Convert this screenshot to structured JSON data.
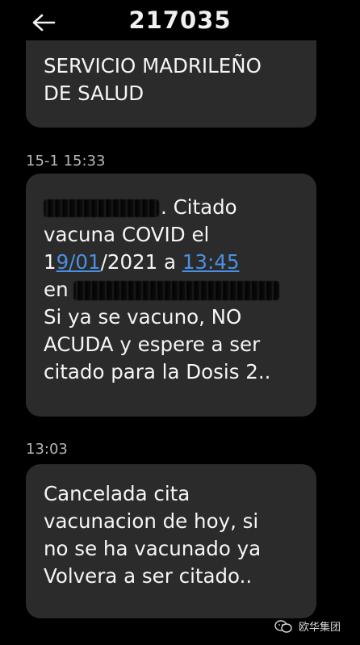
{
  "header": {
    "back_icon": "back-arrow-icon",
    "title": "217035"
  },
  "messages": [
    {
      "lines": [
        "SERVICIO MADRILEÑO",
        "DE SALUD"
      ]
    },
    {
      "timestamp": "15-1 15:33",
      "line1_text": ". Citado",
      "line2": "vacuna COVID el",
      "line3_pre": "1",
      "line3_link_date": "9/01",
      "line3_mid": "/2021 a ",
      "line3_link_time": "13:45",
      "line4_pre": "en",
      "line5": "Si ya se vacuno, NO",
      "line6": "ACUDA y espere a ser",
      "line7": "citado para la Dosis 2.."
    },
    {
      "timestamp": "13:03",
      "lines": [
        "Cancelada cita",
        "vacunacion de hoy, si",
        "no se ha vacunado ya",
        "Volvera a ser citado.."
      ]
    }
  ],
  "watermark": {
    "icon": "wechat-icon",
    "text": "欧华集团"
  },
  "colors": {
    "background": "#000000",
    "bubble": "#2b2b2b",
    "link": "#4a90e2"
  }
}
